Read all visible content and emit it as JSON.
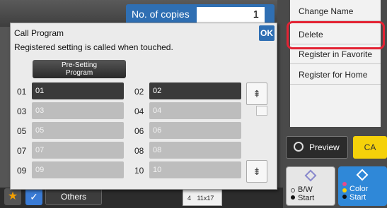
{
  "header": {
    "copies_label": "No. of copies",
    "copies_value": "1"
  },
  "side_menu": {
    "items": [
      "Change Name",
      "Delete",
      "Register in Favorite",
      "Register for Home"
    ]
  },
  "actions": {
    "preview": "Preview",
    "ca": "CA",
    "bw": "B/W",
    "bw_sub": "Start",
    "color": "Color",
    "color_sub": "Start"
  },
  "footer": {
    "others": "Others",
    "paper": "11x17",
    "paper_tray": "4"
  },
  "dialog": {
    "title": "Call Program",
    "subtitle": "Registered setting is called when touched.",
    "ok": "OK",
    "preset_line1": "Pre-Setting",
    "preset_line2": "Program",
    "slots": [
      {
        "num": "01",
        "label": "01",
        "active": true
      },
      {
        "num": "02",
        "label": "02",
        "active": true
      },
      {
        "num": "03",
        "label": "03",
        "active": false
      },
      {
        "num": "04",
        "label": "04",
        "active": false
      },
      {
        "num": "05",
        "label": "05",
        "active": false
      },
      {
        "num": "06",
        "label": "06",
        "active": false
      },
      {
        "num": "07",
        "label": "07",
        "active": false
      },
      {
        "num": "08",
        "label": "08",
        "active": false
      },
      {
        "num": "09",
        "label": "09",
        "active": false
      },
      {
        "num": "10",
        "label": "10",
        "active": false
      }
    ]
  },
  "colors": {
    "accent_blue": "#2f6fb3",
    "highlight_red": "#e32233",
    "ca_yellow": "#f5d10a"
  }
}
